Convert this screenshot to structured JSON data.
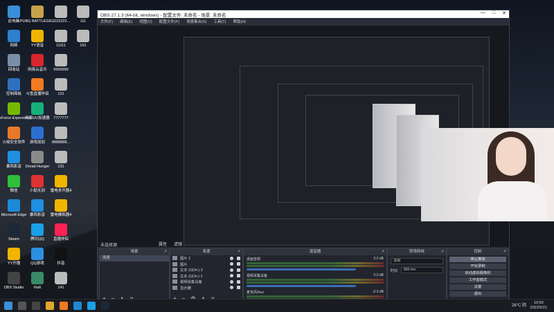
{
  "desktop": {
    "icons": [
      {
        "label": "此电脑",
        "color": "#3a8fd8"
      },
      {
        "label": "网络",
        "color": "#2d7fd0"
      },
      {
        "label": "回收站",
        "color": "#7a8fa6"
      },
      {
        "label": "控制面板",
        "color": "#2f6fc0"
      },
      {
        "label": "GeForce Experience",
        "color": "#76b900"
      },
      {
        "label": "火绒安全软件",
        "color": "#e6792a"
      },
      {
        "label": "暴风影音",
        "color": "#1f8fe0"
      },
      {
        "label": "微信",
        "color": "#2fbf3a"
      },
      {
        "label": "Microsoft Edge",
        "color": "#1d8ad8"
      },
      {
        "label": "Steam",
        "color": "#1b2838"
      },
      {
        "label": "YY开播",
        "color": "#f1b400"
      },
      {
        "label": "OBS Studio",
        "color": "#444"
      },
      {
        "label": "PUBG BATTLEGR...",
        "color": "#c8a24a"
      },
      {
        "label": "YY语音",
        "color": "#f1b400"
      },
      {
        "label": "网易云音乐",
        "color": "#d8262c"
      },
      {
        "label": "斗鱼直播伴侣",
        "color": "#f27a22"
      },
      {
        "label": "网易UU加速器",
        "color": "#16b07a"
      },
      {
        "label": "游戏加加",
        "color": "#2d6fd0"
      },
      {
        "label": "Dread Hunger",
        "color": "#8a8a8a"
      },
      {
        "label": "小助无间",
        "color": "#d33"
      },
      {
        "label": "暴风影音",
        "color": "#1f8fe0"
      },
      {
        "label": "腾讯QQ",
        "color": "#1aa0e8"
      },
      {
        "label": "QQ游戏",
        "color": "#2d8fe0"
      },
      {
        "label": "Raft",
        "color": "#3a8a6a"
      },
      {
        "label": "2222222...",
        "color": "#bbb"
      },
      {
        "label": "11111",
        "color": "#bbb"
      },
      {
        "label": "9999999",
        "color": "#bbb"
      },
      {
        "label": "121",
        "color": "#bbb"
      },
      {
        "label": "7777777",
        "color": "#bbb"
      },
      {
        "label": "8888888...",
        "color": "#bbb"
      },
      {
        "label": "131",
        "color": "#bbb"
      },
      {
        "label": "雷电多开器4",
        "color": "#f1b400"
      },
      {
        "label": "雷电模拟器4",
        "color": "#f1b400"
      },
      {
        "label": "直播伴侣",
        "color": "#f25"
      },
      {
        "label": "抖音",
        "color": "#111"
      },
      {
        "label": "141",
        "color": "#bbb"
      },
      {
        "label": "111",
        "color": "#bbb"
      },
      {
        "label": "161",
        "color": "#bbb"
      }
    ]
  },
  "obs": {
    "title": "OBS 27.1.3 (64-bit, windows) - 配置文件: 未命名 - 场景: 未命名",
    "window_controls": [
      "—",
      "□",
      "✕"
    ],
    "menu": [
      "文件(F)",
      "编辑(E)",
      "视图(V)",
      "配置文件(P)",
      "场景集合(S)",
      "工具(T)",
      "帮助(H)"
    ],
    "preview_label": "未选择源",
    "toolbar_props": "属性",
    "toolbar_filters": "滤镜",
    "scenes": {
      "header": "场景",
      "items": [
        "场景"
      ]
    },
    "sources": {
      "header": "来源",
      "items": [
        "图片 2",
        "图片",
        "文本 (GDI+) 3",
        "文本 (GDI+) 2",
        "视频采集设备",
        "显示器"
      ]
    },
    "mixer": {
      "header": "混音器",
      "channels": [
        {
          "name": "桌面音频",
          "db": "0.0 dB"
        },
        {
          "name": "视频采集设备",
          "db": "0.0 dB"
        },
        {
          "name": "麦克风/Aux",
          "db": "-0.0 dB"
        }
      ]
    },
    "transitions": {
      "header": "转场特效",
      "type": "淡出",
      "duration_label": "时长",
      "duration": "300 ms"
    },
    "controls": {
      "header": "控制",
      "buttons": [
        "停止推流",
        "开始录制",
        "启动虚拟摄像机",
        "工作室模式",
        "设置",
        "退出"
      ]
    },
    "dock_controls": [
      "+",
      "−",
      "∧",
      "∨"
    ]
  },
  "taskbar": {
    "weather": "28°C 阴",
    "time": "10:59",
    "date": "2022/5/21"
  }
}
